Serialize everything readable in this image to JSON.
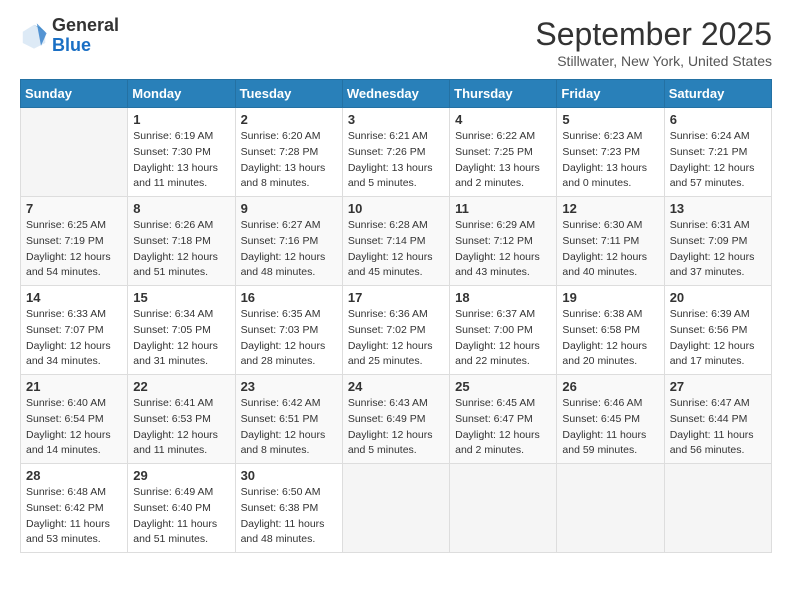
{
  "header": {
    "logo_general": "General",
    "logo_blue": "Blue",
    "month_title": "September 2025",
    "subtitle": "Stillwater, New York, United States"
  },
  "days_of_week": [
    "Sunday",
    "Monday",
    "Tuesday",
    "Wednesday",
    "Thursday",
    "Friday",
    "Saturday"
  ],
  "weeks": [
    [
      {
        "day": "",
        "info": ""
      },
      {
        "day": "1",
        "info": "Sunrise: 6:19 AM\nSunset: 7:30 PM\nDaylight: 13 hours\nand 11 minutes."
      },
      {
        "day": "2",
        "info": "Sunrise: 6:20 AM\nSunset: 7:28 PM\nDaylight: 13 hours\nand 8 minutes."
      },
      {
        "day": "3",
        "info": "Sunrise: 6:21 AM\nSunset: 7:26 PM\nDaylight: 13 hours\nand 5 minutes."
      },
      {
        "day": "4",
        "info": "Sunrise: 6:22 AM\nSunset: 7:25 PM\nDaylight: 13 hours\nand 2 minutes."
      },
      {
        "day": "5",
        "info": "Sunrise: 6:23 AM\nSunset: 7:23 PM\nDaylight: 13 hours\nand 0 minutes."
      },
      {
        "day": "6",
        "info": "Sunrise: 6:24 AM\nSunset: 7:21 PM\nDaylight: 12 hours\nand 57 minutes."
      }
    ],
    [
      {
        "day": "7",
        "info": "Sunrise: 6:25 AM\nSunset: 7:19 PM\nDaylight: 12 hours\nand 54 minutes."
      },
      {
        "day": "8",
        "info": "Sunrise: 6:26 AM\nSunset: 7:18 PM\nDaylight: 12 hours\nand 51 minutes."
      },
      {
        "day": "9",
        "info": "Sunrise: 6:27 AM\nSunset: 7:16 PM\nDaylight: 12 hours\nand 48 minutes."
      },
      {
        "day": "10",
        "info": "Sunrise: 6:28 AM\nSunset: 7:14 PM\nDaylight: 12 hours\nand 45 minutes."
      },
      {
        "day": "11",
        "info": "Sunrise: 6:29 AM\nSunset: 7:12 PM\nDaylight: 12 hours\nand 43 minutes."
      },
      {
        "day": "12",
        "info": "Sunrise: 6:30 AM\nSunset: 7:11 PM\nDaylight: 12 hours\nand 40 minutes."
      },
      {
        "day": "13",
        "info": "Sunrise: 6:31 AM\nSunset: 7:09 PM\nDaylight: 12 hours\nand 37 minutes."
      }
    ],
    [
      {
        "day": "14",
        "info": "Sunrise: 6:33 AM\nSunset: 7:07 PM\nDaylight: 12 hours\nand 34 minutes."
      },
      {
        "day": "15",
        "info": "Sunrise: 6:34 AM\nSunset: 7:05 PM\nDaylight: 12 hours\nand 31 minutes."
      },
      {
        "day": "16",
        "info": "Sunrise: 6:35 AM\nSunset: 7:03 PM\nDaylight: 12 hours\nand 28 minutes."
      },
      {
        "day": "17",
        "info": "Sunrise: 6:36 AM\nSunset: 7:02 PM\nDaylight: 12 hours\nand 25 minutes."
      },
      {
        "day": "18",
        "info": "Sunrise: 6:37 AM\nSunset: 7:00 PM\nDaylight: 12 hours\nand 22 minutes."
      },
      {
        "day": "19",
        "info": "Sunrise: 6:38 AM\nSunset: 6:58 PM\nDaylight: 12 hours\nand 20 minutes."
      },
      {
        "day": "20",
        "info": "Sunrise: 6:39 AM\nSunset: 6:56 PM\nDaylight: 12 hours\nand 17 minutes."
      }
    ],
    [
      {
        "day": "21",
        "info": "Sunrise: 6:40 AM\nSunset: 6:54 PM\nDaylight: 12 hours\nand 14 minutes."
      },
      {
        "day": "22",
        "info": "Sunrise: 6:41 AM\nSunset: 6:53 PM\nDaylight: 12 hours\nand 11 minutes."
      },
      {
        "day": "23",
        "info": "Sunrise: 6:42 AM\nSunset: 6:51 PM\nDaylight: 12 hours\nand 8 minutes."
      },
      {
        "day": "24",
        "info": "Sunrise: 6:43 AM\nSunset: 6:49 PM\nDaylight: 12 hours\nand 5 minutes."
      },
      {
        "day": "25",
        "info": "Sunrise: 6:45 AM\nSunset: 6:47 PM\nDaylight: 12 hours\nand 2 minutes."
      },
      {
        "day": "26",
        "info": "Sunrise: 6:46 AM\nSunset: 6:45 PM\nDaylight: 11 hours\nand 59 minutes."
      },
      {
        "day": "27",
        "info": "Sunrise: 6:47 AM\nSunset: 6:44 PM\nDaylight: 11 hours\nand 56 minutes."
      }
    ],
    [
      {
        "day": "28",
        "info": "Sunrise: 6:48 AM\nSunset: 6:42 PM\nDaylight: 11 hours\nand 53 minutes."
      },
      {
        "day": "29",
        "info": "Sunrise: 6:49 AM\nSunset: 6:40 PM\nDaylight: 11 hours\nand 51 minutes."
      },
      {
        "day": "30",
        "info": "Sunrise: 6:50 AM\nSunset: 6:38 PM\nDaylight: 11 hours\nand 48 minutes."
      },
      {
        "day": "",
        "info": ""
      },
      {
        "day": "",
        "info": ""
      },
      {
        "day": "",
        "info": ""
      },
      {
        "day": "",
        "info": ""
      }
    ]
  ]
}
